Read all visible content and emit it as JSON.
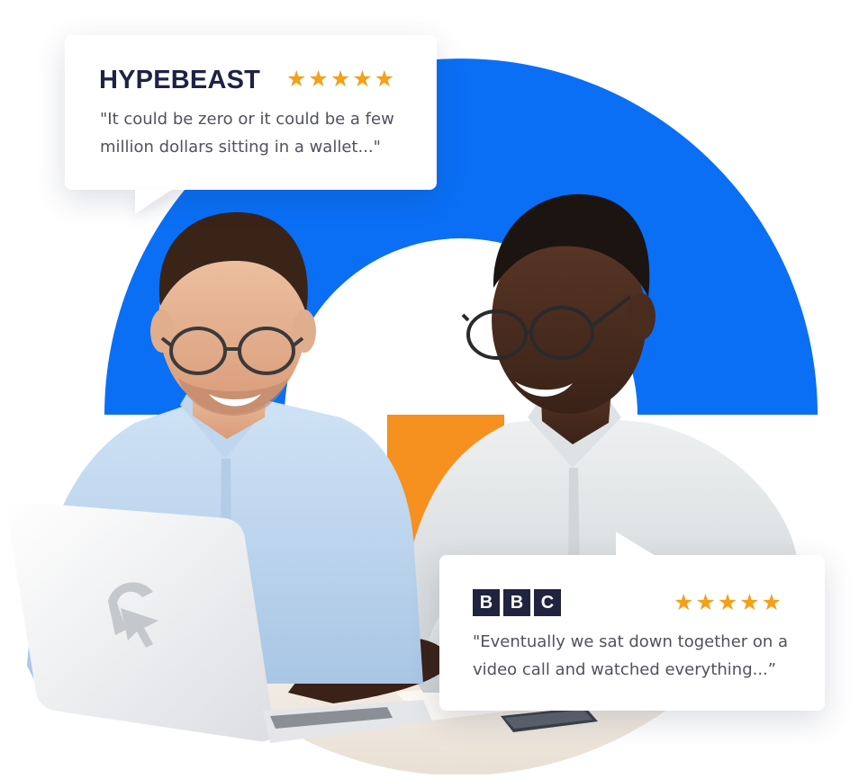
{
  "colors": {
    "ring_blue": "#0a6ff5",
    "ring_orange": "#f6901e",
    "star_gold": "#f5a018",
    "brand_navy": "#1f2247",
    "text_gray": "#50525d",
    "card_white": "#ffffff"
  },
  "testimonials": [
    {
      "brand": "HYPEBEAST",
      "rating_stars": "★★★★★",
      "rating": 5,
      "quote": "\"It could be zero or it could be a few million dollars sitting in a wallet...\""
    },
    {
      "brand_letters": [
        "B",
        "B",
        "C"
      ],
      "rating_stars": "★★★★★",
      "rating": 5,
      "quote": "\"Eventually we sat down together on a video call and watched everything...”"
    }
  ],
  "icons": {
    "laptop_logo": "cursor-arrow-logo-icon",
    "star": "star-icon"
  }
}
